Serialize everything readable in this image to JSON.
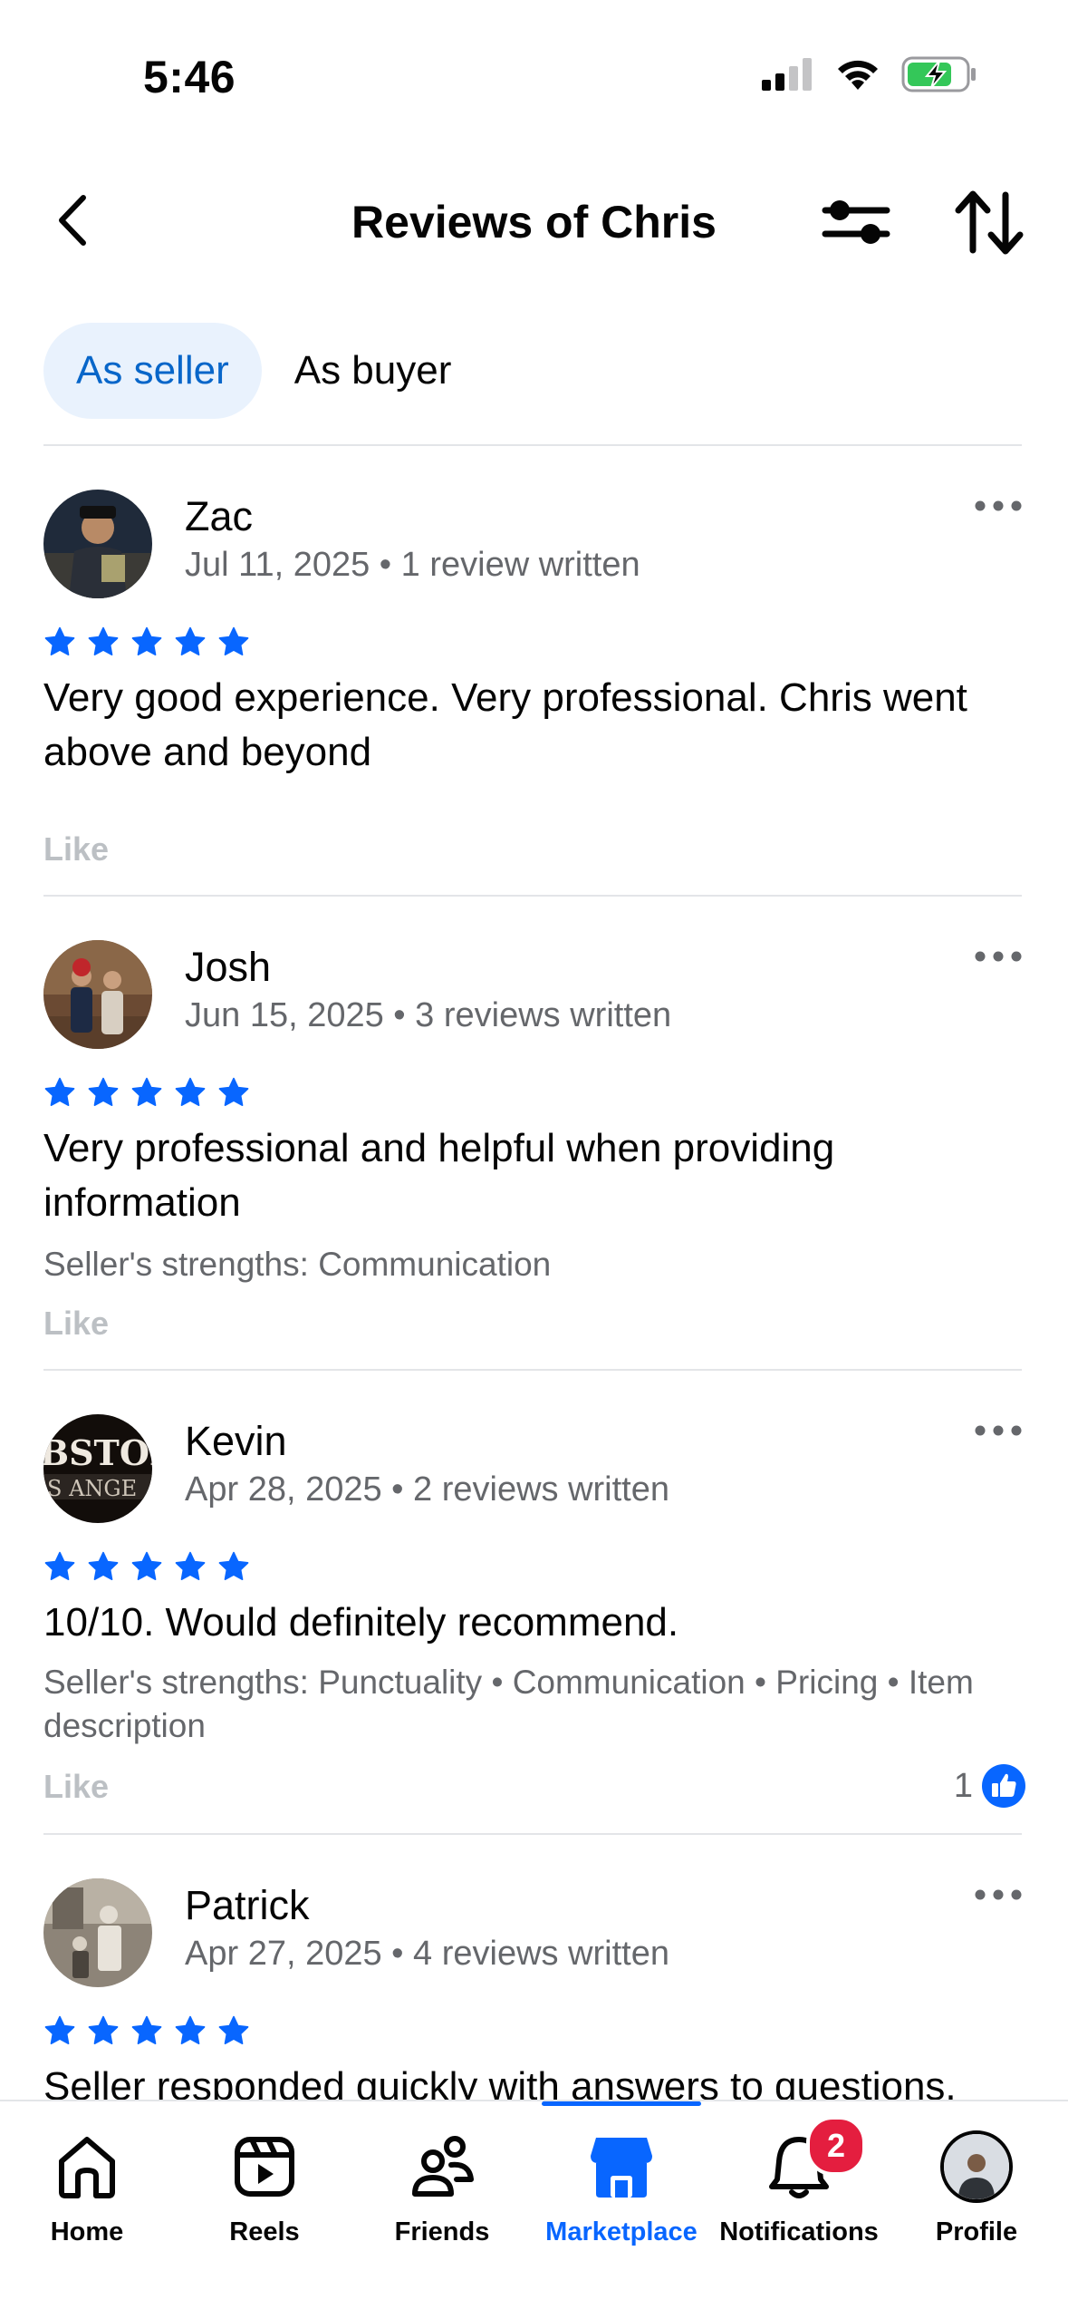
{
  "status_bar": {
    "time": "5:46"
  },
  "header": {
    "title": "Reviews of Chris"
  },
  "tabs": [
    {
      "label": "As seller",
      "active": true
    },
    {
      "label": "As buyer",
      "active": false
    }
  ],
  "reviews": [
    {
      "name": "Zac",
      "date": "Jul 11, 2025",
      "reviews_written": "1 review written",
      "stars": 5,
      "text": "Very good experience. Very professional. Chris went above and beyond",
      "strengths": "",
      "like_label": "Like",
      "like_count": ""
    },
    {
      "name": "Josh",
      "date": "Jun 15, 2025",
      "reviews_written": "3 reviews written",
      "stars": 5,
      "text": "Very professional and helpful when providing information",
      "strengths": "Seller's strengths: Communication",
      "like_label": "Like",
      "like_count": ""
    },
    {
      "name": "Kevin",
      "date": "Apr 28, 2025",
      "reviews_written": "2 reviews written",
      "stars": 5,
      "text": "10/10. Would definitely recommend.",
      "strengths": "Seller's strengths: Punctuality • Communication • Pricing • Item description",
      "like_label": "Like",
      "like_count": "1"
    },
    {
      "name": "Patrick",
      "date": "Apr 27, 2025",
      "reviews_written": "4 reviews written",
      "stars": 5,
      "text": "Seller responded quickly with answers to questions.",
      "strengths": "",
      "like_label": "Like",
      "like_count": ""
    }
  ],
  "tab_bar": {
    "items": [
      {
        "label": "Home",
        "icon": "home-icon"
      },
      {
        "label": "Reels",
        "icon": "reels-icon"
      },
      {
        "label": "Friends",
        "icon": "friends-icon"
      },
      {
        "label": "Marketplace",
        "icon": "marketplace-icon",
        "active": true
      },
      {
        "label": "Notifications",
        "icon": "bell-icon",
        "badge": "2"
      },
      {
        "label": "Profile",
        "icon": "avatar"
      }
    ]
  },
  "colors": {
    "accent": "#0866ff",
    "tab_active_bg": "#e9f2fd",
    "badge": "#e41e3f",
    "star": "#0866ff"
  }
}
